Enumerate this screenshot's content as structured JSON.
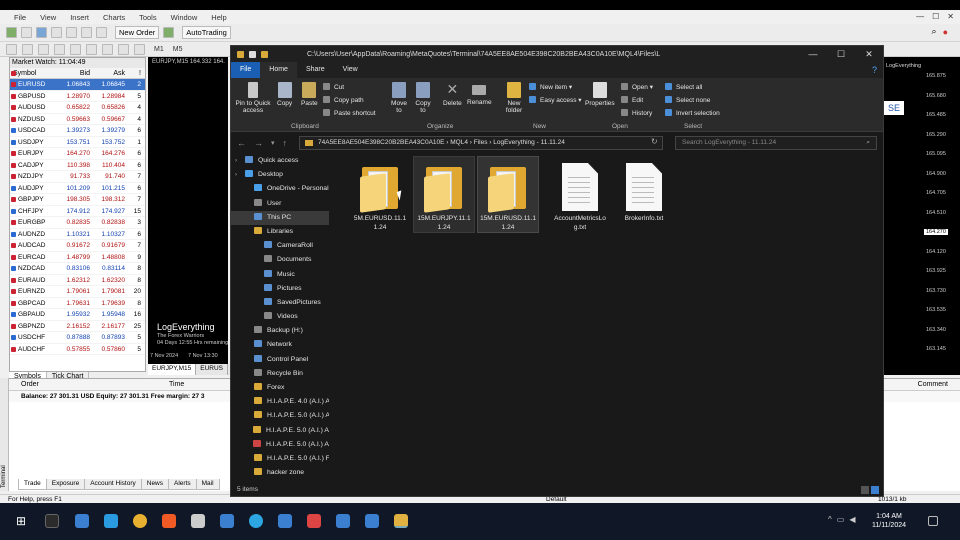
{
  "mt4": {
    "menu": [
      "File",
      "View",
      "Insert",
      "Charts",
      "Tools",
      "Window",
      "Help"
    ],
    "toolbar": {
      "new_order": "New Order",
      "autotrading": "AutoTrading",
      "timeframes": [
        "M1",
        "M5",
        "M15",
        "M30",
        "H1",
        "H4",
        "D1",
        "W1",
        "MN"
      ]
    },
    "market_watch": {
      "title": "Market Watch: 11:04:49",
      "columns": [
        "Symbol",
        "Bid",
        "Ask",
        "!"
      ],
      "rows": [
        {
          "s": "EURUSD",
          "b": "1.06843",
          "a": "1.06845",
          "sp": "2",
          "sel": true
        },
        {
          "s": "GBPUSD",
          "b": "1.28970",
          "a": "1.28984",
          "sp": "5"
        },
        {
          "s": "AUDUSD",
          "b": "0.65822",
          "a": "0.65826",
          "sp": "4"
        },
        {
          "s": "NZDUSD",
          "b": "0.59663",
          "a": "0.59667",
          "sp": "4"
        },
        {
          "s": "USDCAD",
          "b": "1.39273",
          "a": "1.39279",
          "sp": "6",
          "up": true
        },
        {
          "s": "USDJPY",
          "b": "153.751",
          "a": "153.752",
          "sp": "1",
          "up": true
        },
        {
          "s": "EURJPY",
          "b": "164.270",
          "a": "164.276",
          "sp": "6"
        },
        {
          "s": "CADJPY",
          "b": "110.398",
          "a": "110.404",
          "sp": "6"
        },
        {
          "s": "NZDJPY",
          "b": "91.733",
          "a": "91.740",
          "sp": "7"
        },
        {
          "s": "AUDJPY",
          "b": "101.209",
          "a": "101.215",
          "sp": "6",
          "up": true
        },
        {
          "s": "GBPJPY",
          "b": "198.305",
          "a": "198.312",
          "sp": "7"
        },
        {
          "s": "CHFJPY",
          "b": "174.912",
          "a": "174.927",
          "sp": "15",
          "up": true
        },
        {
          "s": "EURGBP",
          "b": "0.82835",
          "a": "0.82838",
          "sp": "3"
        },
        {
          "s": "AUDNZD",
          "b": "1.10321",
          "a": "1.10327",
          "sp": "6",
          "up": true
        },
        {
          "s": "AUDCAD",
          "b": "0.91672",
          "a": "0.91679",
          "sp": "7"
        },
        {
          "s": "EURCAD",
          "b": "1.48799",
          "a": "1.48808",
          "sp": "9"
        },
        {
          "s": "NZDCAD",
          "b": "0.83106",
          "a": "0.83114",
          "sp": "8",
          "up": true
        },
        {
          "s": "EURAUD",
          "b": "1.62312",
          "a": "1.62320",
          "sp": "8"
        },
        {
          "s": "EURNZD",
          "b": "1.79061",
          "a": "1.79081",
          "sp": "20"
        },
        {
          "s": "GBPCAD",
          "b": "1.79631",
          "a": "1.79639",
          "sp": "8"
        },
        {
          "s": "GBPAUD",
          "b": "1.95932",
          "a": "1.95948",
          "sp": "16",
          "up": true
        },
        {
          "s": "GBPNZD",
          "b": "2.16152",
          "a": "2.16177",
          "sp": "25"
        },
        {
          "s": "USDCHF",
          "b": "0.87888",
          "a": "0.87893",
          "sp": "5",
          "up": true
        },
        {
          "s": "AUDCHF",
          "b": "0.57855",
          "a": "0.57860",
          "sp": "5"
        }
      ],
      "tabs": [
        "Symbols",
        "Tick Chart"
      ]
    },
    "chart": {
      "title": "EURJPY,M15  164.332 164.",
      "ea_title": "LogEverything",
      "ea_sub1": "The Forex Warriors",
      "ea_sub2": "04 Days 12:55 Hrs remaining",
      "dates": [
        "7 Nov 2024",
        "7 Nov 13:30"
      ],
      "tabs": [
        "EURJPY,M15",
        "EURUS"
      ]
    },
    "chart_right": {
      "symbol": "LogEverything",
      "close_label": "SE",
      "prices": [
        "165.875",
        "165.680",
        "165.485",
        "165.290",
        "165.095",
        "164.900",
        "164.705",
        "164.510",
        "164.270",
        "164.120",
        "163.925",
        "163.730",
        "163.535",
        "163.340",
        "163.145"
      ]
    },
    "terminal": {
      "columns": [
        "Order",
        "Time",
        "Comment"
      ],
      "balance": "Balance: 27 301.31 USD  Equity: 27 301.31  Free margin: 27 3",
      "tabs": [
        "Trade",
        "Exposure",
        "Account History",
        "News",
        "Alerts",
        "Mail"
      ],
      "side": "Terminal"
    },
    "status": {
      "help": "For Help, press F1",
      "profile": "Default",
      "traffic": "1013/1 kb"
    }
  },
  "explorer": {
    "title_path": "C:\\Users\\User\\AppData\\Roaming\\MetaQuotes\\Terminal\\74A5EE8AE504E398C20B2BEA43C0A10E\\MQL4\\Files\\L",
    "window_controls": [
      "—",
      "☐",
      "✕"
    ],
    "ribbon_tabs": [
      "File",
      "Home",
      "Share",
      "View"
    ],
    "ribbon": {
      "pin": "Pin to Quick access",
      "copy": "Copy",
      "paste": "Paste",
      "cut": "Cut",
      "copy_path": "Copy path",
      "paste_shortcut": "Paste shortcut",
      "move_to": "Move to",
      "copy_to": "Copy to",
      "delete": "Delete",
      "rename": "Rename",
      "new_folder": "New folder",
      "new_item": "New item",
      "easy_access": "Easy access",
      "properties": "Properties",
      "open": "Open",
      "edit": "Edit",
      "history": "History",
      "select_all": "Select all",
      "select_none": "Select none",
      "invert": "Invert selection",
      "groups": [
        "Clipboard",
        "Organize",
        "New",
        "Open",
        "Select"
      ]
    },
    "address": {
      "crumbs": "74A5EE8AE504E398C20B2BEA43C0A10E  ›  MQL4  ›  Files  ›  LogEverything - 11.11.24",
      "search_placeholder": "Search LogEverything - 11.11.24"
    },
    "nav": [
      {
        "t": "Quick access",
        "i": "b",
        "c": "l1"
      },
      {
        "t": "Desktop",
        "i": "c",
        "c": "l1"
      },
      {
        "t": "OneDrive - Personal",
        "i": "c",
        "c": "l2"
      },
      {
        "t": "User",
        "i": "g",
        "c": "l2"
      },
      {
        "t": "This PC",
        "i": "b",
        "c": "l2 sel"
      },
      {
        "t": "Libraries",
        "i": "f",
        "c": "l2"
      },
      {
        "t": "CameraRoll",
        "i": "b",
        "c": "l3"
      },
      {
        "t": "Documents",
        "i": "g",
        "c": "l3"
      },
      {
        "t": "Music",
        "i": "b",
        "c": "l3"
      },
      {
        "t": "Pictures",
        "i": "b",
        "c": "l3"
      },
      {
        "t": "SavedPictures",
        "i": "b",
        "c": "l3"
      },
      {
        "t": "Videos",
        "i": "g",
        "c": "l3"
      },
      {
        "t": "Backup (H:)",
        "i": "g",
        "c": "l2"
      },
      {
        "t": "Network",
        "i": "b",
        "c": "l2"
      },
      {
        "t": "Control Panel",
        "i": "b",
        "c": "l2"
      },
      {
        "t": "Recycle Bin",
        "i": "g",
        "c": "l2"
      },
      {
        "t": "Forex",
        "i": "f",
        "c": "l2"
      },
      {
        "t": "H.I.A.P.E. 4.0 (A.I.) Ar",
        "i": "f",
        "c": "l2"
      },
      {
        "t": "H.I.A.P.E. 5.0 (A.I.) Ar",
        "i": "f",
        "c": "l2"
      },
      {
        "t": "H.I.A.P.E. 5.0 (A.I.) A",
        "i": "f",
        "c": "l4"
      },
      {
        "t": "H.I.A.P.E. 5.0 (A.I.) A",
        "i": "r",
        "c": "l4"
      },
      {
        "t": "H.I.A.P.E. 5.0 (A.I.) Fo",
        "i": "f",
        "c": "l2"
      },
      {
        "t": "hacker zone",
        "i": "f",
        "c": "l2"
      }
    ],
    "files": [
      {
        "n": "5M.EURUSD.11.11.24",
        "type": "folder"
      },
      {
        "n": "15M.EURJPY.11.11.24",
        "type": "folder",
        "state": "hov"
      },
      {
        "n": "15M.EURUSD.11.11.24",
        "type": "folder",
        "state": "sel"
      },
      {
        "n": "AccountMetricsLog.txt",
        "type": "doc"
      },
      {
        "n": "BrokerInfo.txt",
        "type": "doc"
      }
    ],
    "status": "5 items"
  },
  "taskbar": {
    "time": "1:04 AM",
    "date": "11/11/2024"
  }
}
